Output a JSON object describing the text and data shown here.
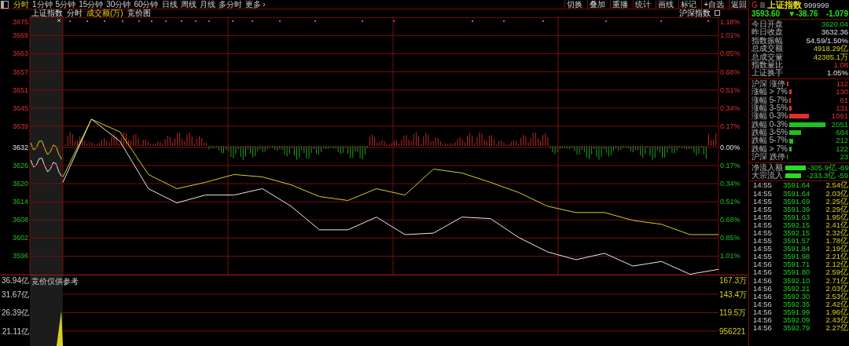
{
  "toolbar": {
    "tabs": [
      {
        "label": "分时",
        "selected": true
      },
      {
        "label": "1分钟",
        "selected": false
      },
      {
        "label": "5分钟",
        "selected": false
      },
      {
        "label": "15分钟",
        "selected": false
      },
      {
        "label": "30分钟",
        "selected": false
      },
      {
        "label": "60分钟",
        "selected": false
      },
      {
        "label": "日线",
        "selected": false
      },
      {
        "label": "周线",
        "selected": false
      },
      {
        "label": "月线",
        "selected": false
      },
      {
        "label": "多分时",
        "selected": false
      },
      {
        "label": "更多 ›",
        "selected": false
      }
    ],
    "tools": [
      "切换",
      "叠加",
      "重播",
      "统计",
      "画线",
      "标记",
      "+自选",
      "返回"
    ]
  },
  "subheader": {
    "items": [
      {
        "label": "上证指数",
        "kind": "title"
      },
      {
        "label": "分时",
        "kind": "title"
      },
      {
        "label": "成交额(万)",
        "kind": "indicator"
      },
      {
        "label": "竞价图",
        "kind": "title"
      }
    ],
    "compare": {
      "label": "沪深指数",
      "checked": false
    }
  },
  "chart": {
    "auction_label": "竞价仅供参考",
    "percent_labels": [
      {
        "label": "1.18%",
        "kind": "up"
      },
      {
        "label": "1.01%",
        "kind": "up"
      },
      {
        "label": "0.85%",
        "kind": "up"
      },
      {
        "label": "0.68%",
        "kind": "up"
      },
      {
        "label": "0.51%",
        "kind": "up"
      },
      {
        "label": "0.34%",
        "kind": "up"
      },
      {
        "label": "0.17%",
        "kind": "up"
      },
      {
        "label": "0.00%",
        "kind": "flat"
      },
      {
        "label": "0.17%",
        "kind": "down"
      },
      {
        "label": "0.34%",
        "kind": "down"
      },
      {
        "label": "0.51%",
        "kind": "down"
      },
      {
        "label": "0.68%",
        "kind": "down"
      },
      {
        "label": "0.85%",
        "kind": "down"
      },
      {
        "label": "1.01%",
        "kind": "down"
      }
    ],
    "volume_left_labels": [
      "36.94亿",
      "31.67亿",
      "26.39亿",
      "21.11亿"
    ],
    "volume_right_labels": [
      "167.3万",
      "143.4万",
      "119.5万",
      "956221"
    ],
    "chart_data": {
      "type": "line",
      "ylim": [
        3589.5,
        3675.2
      ],
      "grid": true,
      "yticks": [
        3675,
        3669,
        3663,
        3657,
        3651,
        3645,
        3639,
        3632,
        3626,
        3620,
        3614,
        3608,
        3602,
        3596
      ],
      "series": [
        {
          "color": "#e8e8e8",
          "values": [
            3620.3,
            3641.2,
            3633.9,
            3618.2,
            3613.5,
            3616.1,
            3616.1,
            3618.2,
            3612.4,
            3604.6,
            3604.6,
            3608.8,
            3603.0,
            3603.5,
            3608.8,
            3608.3,
            3602.0,
            3597.3,
            3594.7,
            3596.8,
            3592.6,
            3594.1,
            3589.9,
            3591.5
          ]
        },
        {
          "color": "#d8d020",
          "values": [
            3622.1,
            3641.2,
            3637.0,
            3622.9,
            3618.2,
            3620.3,
            3622.9,
            3622.1,
            3619.5,
            3615.6,
            3614.3,
            3618.2,
            3616.1,
            3624.7,
            3623.4,
            3620.3,
            3616.9,
            3612.4,
            3610.3,
            3610.3,
            3607.7,
            3606.4,
            3603.0,
            3603.0
          ]
        }
      ]
    }
  },
  "quote": {
    "flag": "G",
    "name": "上证指数",
    "code": "999999",
    "price": "3593.60",
    "change": "▼-38.76",
    "percent": "-1.079"
  },
  "stats": [
    {
      "label": "今日开盘",
      "value": "3620.04",
      "kind": "down"
    },
    {
      "label": "昨日收盘",
      "value": "3632.36",
      "kind": "flat"
    },
    {
      "label": "指数振幅",
      "value": "54.59/1.50%",
      "kind": "flat"
    },
    {
      "label": "总成交额",
      "value": "4918.29亿",
      "kind": "volume"
    },
    {
      "label": "总成交量",
      "value": "42385.1万",
      "kind": "volume"
    },
    {
      "label": "指数量比",
      "value": "1.08",
      "kind": "up"
    },
    {
      "label": "上证换手",
      "value": "1.05%",
      "kind": "flat"
    }
  ],
  "breadth": [
    {
      "label": "沪深 涨停",
      "value": "112",
      "kind": "up"
    },
    {
      "label": "涨幅 > 7%",
      "value": "130",
      "kind": "up"
    },
    {
      "label": "涨幅 5-7%",
      "value": "61",
      "kind": "up"
    },
    {
      "label": "涨幅 3-5%",
      "value": "131",
      "kind": "up"
    },
    {
      "label": "涨幅 0-3%",
      "value": "1091",
      "kind": "up"
    },
    {
      "label": "跌幅 0-3%",
      "value": "2051",
      "kind": "down"
    },
    {
      "label": "跌幅 3-5%",
      "value": "684",
      "kind": "down"
    },
    {
      "label": "跌幅 5-7%",
      "value": "212",
      "kind": "down"
    },
    {
      "label": "跌幅 > 7%",
      "value": "122",
      "kind": "down"
    },
    {
      "label": "沪深 跌停",
      "value": "23",
      "kind": "down"
    }
  ],
  "flows": [
    {
      "label": "净流入额",
      "value": "-305.9亿",
      "value_2": "-69"
    },
    {
      "label": "大宗流入",
      "value": "-233.3亿",
      "value_2": "-59"
    }
  ],
  "ticks": [
    {
      "time": "14:55",
      "price": "3591.64",
      "amount": "2.54亿"
    },
    {
      "time": "14:55",
      "price": "3591.64",
      "amount": "2.03亿"
    },
    {
      "time": "14:55",
      "price": "3591.69",
      "amount": "2.25亿"
    },
    {
      "time": "14:55",
      "price": "3591.39",
      "amount": "2.29亿"
    },
    {
      "time": "14:55",
      "price": "3591.63",
      "amount": "1.95亿"
    },
    {
      "time": "14:55",
      "price": "3592.15",
      "amount": "2.41亿"
    },
    {
      "time": "14:55",
      "price": "3592.15",
      "amount": "2.32亿"
    },
    {
      "time": "14:55",
      "price": "3591.57",
      "amount": "1.78亿"
    },
    {
      "time": "14:55",
      "price": "3591.84",
      "amount": "2.19亿"
    },
    {
      "time": "14:55",
      "price": "3591.98",
      "amount": "2.21亿"
    },
    {
      "time": "14:56",
      "price": "3591.71",
      "amount": "2.12亿"
    },
    {
      "time": "14:56",
      "price": "3591.80",
      "amount": "2.59亿"
    },
    {
      "time": "14:56",
      "price": "3592.10",
      "amount": "2.71亿"
    },
    {
      "time": "14:56",
      "price": "3592.21",
      "amount": "2.03亿"
    },
    {
      "time": "14:56",
      "price": "3592.30",
      "amount": "2.53亿"
    },
    {
      "time": "14:56",
      "price": "3592.35",
      "amount": "2.42亿"
    },
    {
      "time": "14:56",
      "price": "3591.99",
      "amount": "1.96亿"
    },
    {
      "time": "14:56",
      "price": "3592.09",
      "amount": "2.43亿"
    },
    {
      "time": "14:56",
      "price": "3592.79",
      "amount": "2.27亿"
    }
  ]
}
